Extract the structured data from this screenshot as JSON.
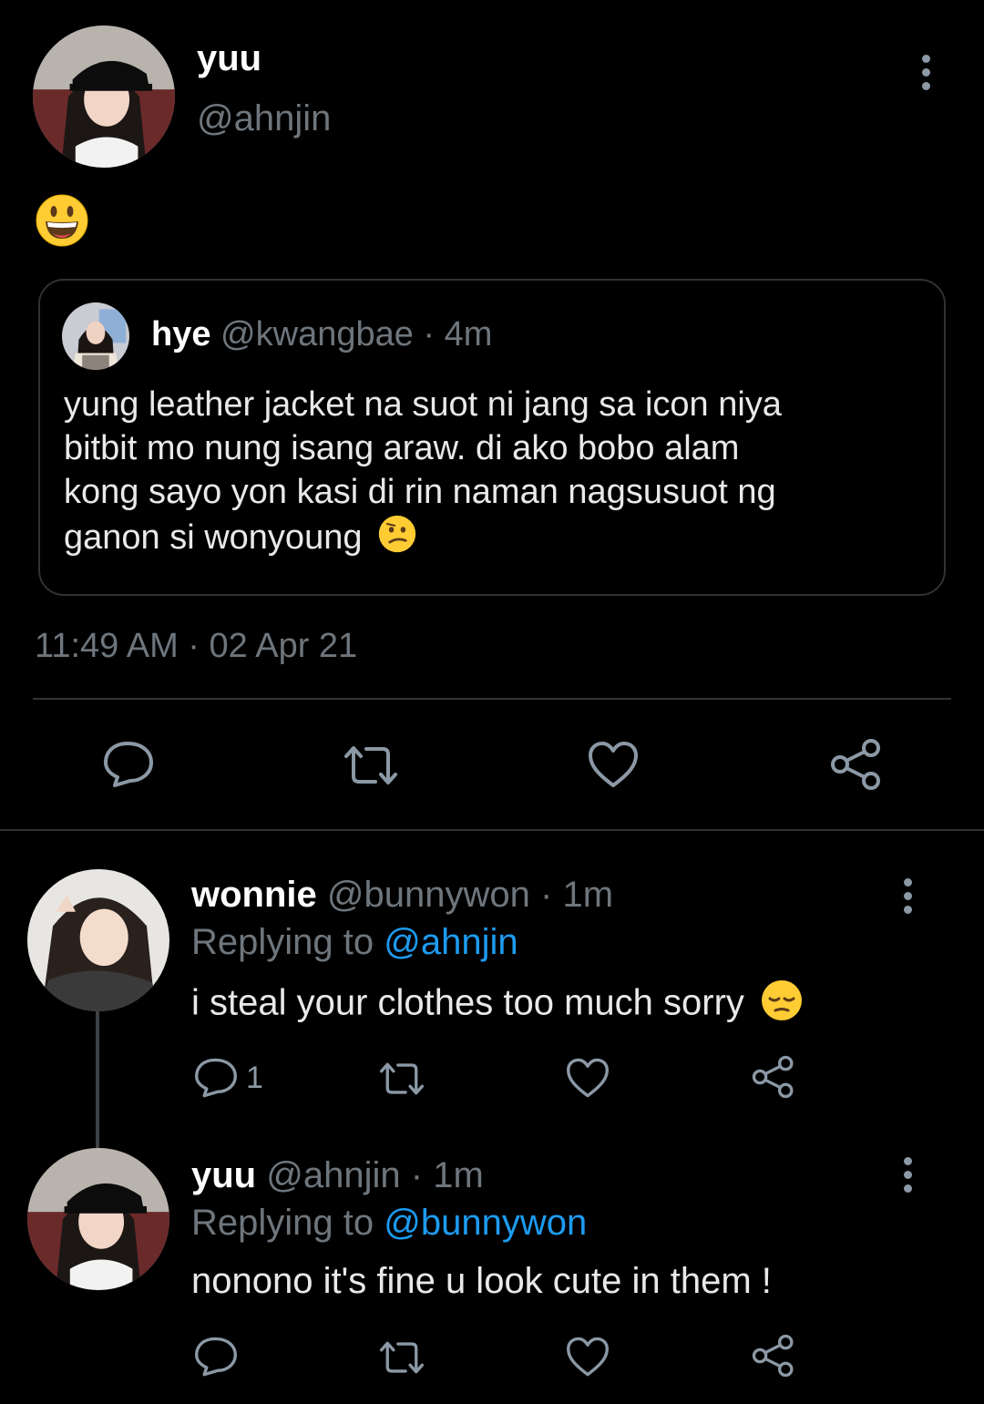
{
  "main_tweet": {
    "name": "yuu",
    "handle": "@ahnjin",
    "text_emoji": "grinning-face-emoji",
    "quoted": {
      "name": "hye",
      "handle": "@kwangbae",
      "sep": "·",
      "time": "4m",
      "lines": [
        "yung leather jacket na suot ni jang sa icon niya",
        "bitbit mo nung isang araw. di ako bobo alam",
        "kong sayo yon kasi di rin naman nagsusuot ng",
        "ganon si wonyoung"
      ],
      "trailing_emoji": "confused-face-emoji"
    },
    "timestamp": "11:49 AM · 02 Apr 21",
    "actions": [
      "reply-icon",
      "retweet-icon",
      "like-icon",
      "share-icon"
    ]
  },
  "replies": [
    {
      "name": "wonnie",
      "handle": "@bunnywon",
      "sep": "·",
      "time": "1m",
      "replying_prefix": "Replying to",
      "replying_to": "@ahnjin",
      "text": "i steal your clothes too much sorry",
      "trailing_emoji": "pensive-face-emoji",
      "reply_count": "1"
    },
    {
      "name": "yuu",
      "handle": "@ahnjin",
      "sep": "·",
      "time": "1m",
      "replying_prefix": "Replying to",
      "replying_to": "@bunnywon",
      "text": "nonono it's fine u look cute in them !",
      "reply_count": ""
    }
  ],
  "colors": {
    "background": "#000000",
    "muted": "#6e767d",
    "link": "#1d9bf0",
    "divider": "#2f3336"
  }
}
